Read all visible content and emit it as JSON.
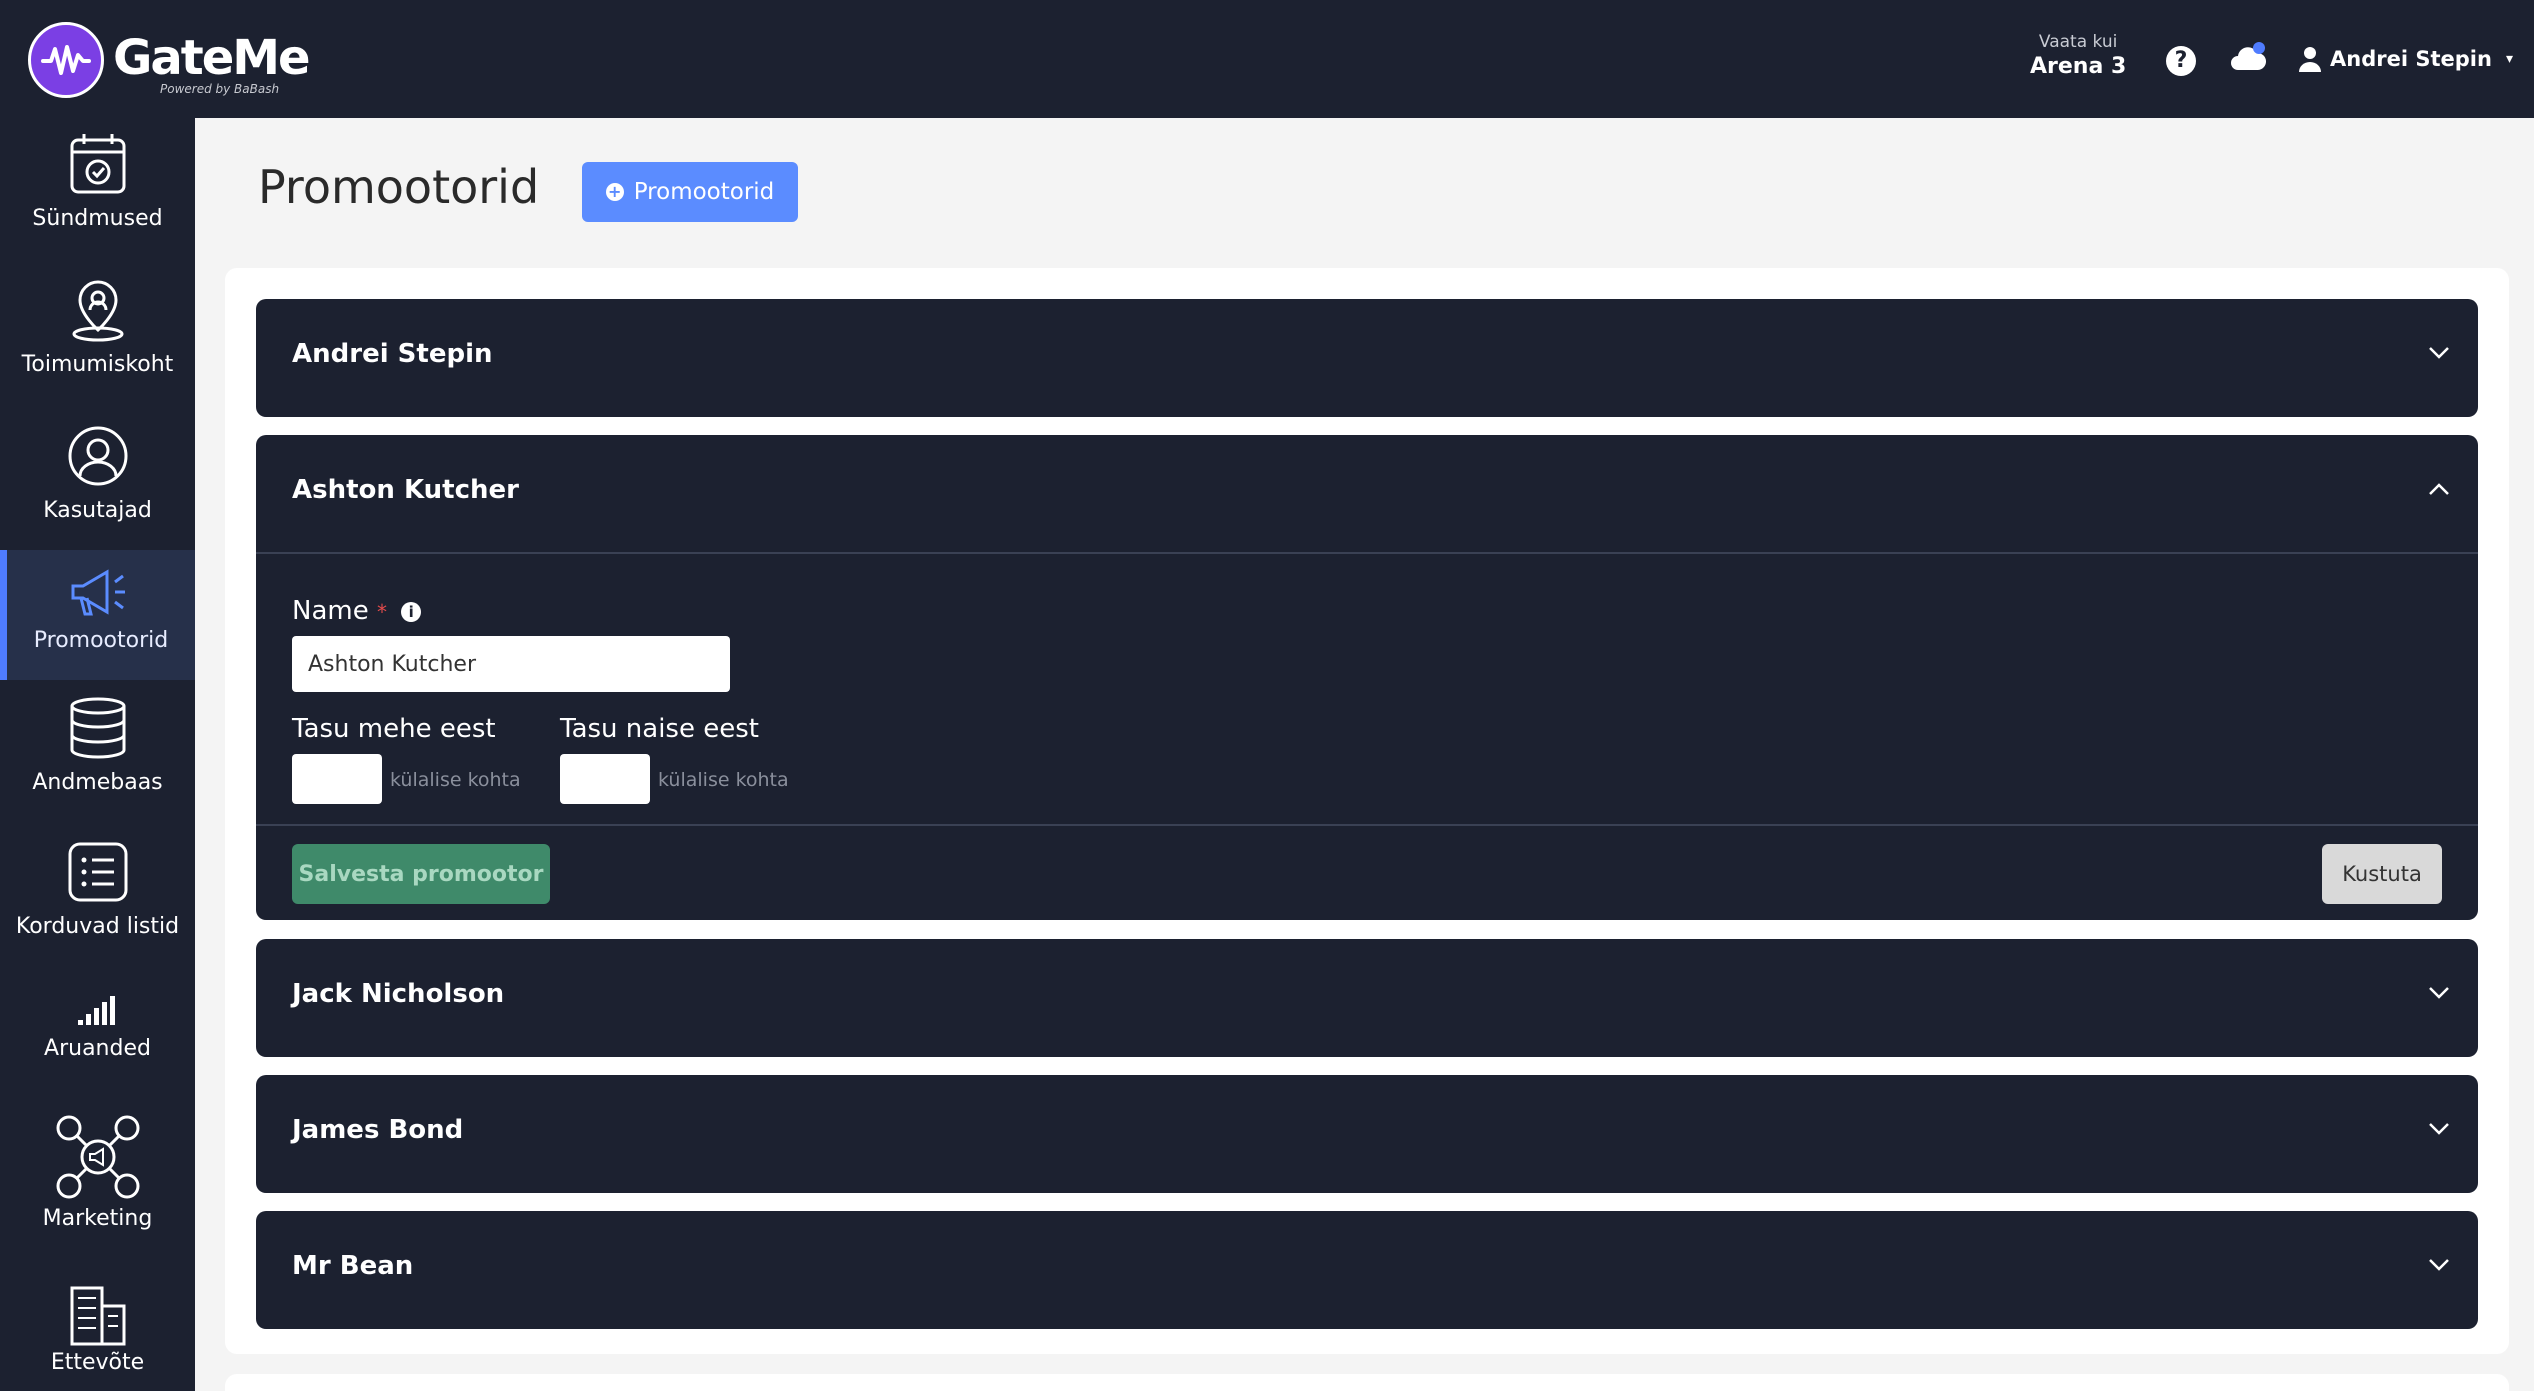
{
  "header": {
    "brand": "GateMe",
    "brand_sub": "Powered by BaBash",
    "view_as_label": "Vaata kui",
    "view_as_value": "Arena 3",
    "help_glyph": "?",
    "user_name": "Andrei Stepin"
  },
  "sidebar": {
    "items": [
      {
        "label": "Sündmused",
        "icon": "calendar-check-icon"
      },
      {
        "label": "Toimumiskoht",
        "icon": "map-pin-icon"
      },
      {
        "label": "Kasutajad",
        "icon": "user-circle-icon"
      },
      {
        "label": "Promootorid",
        "icon": "megaphone-icon"
      },
      {
        "label": "Andmebaas",
        "icon": "database-icon"
      },
      {
        "label": "Korduvad listid",
        "icon": "list-icon"
      },
      {
        "label": "Aruanded",
        "icon": "signal-bars-icon"
      },
      {
        "label": "Marketing",
        "icon": "social-network-icon"
      },
      {
        "label": "Ettevõte",
        "icon": "building-icon"
      }
    ],
    "active_index": 3
  },
  "main": {
    "title": "Promootorid",
    "add_button_label": "Promootorid"
  },
  "promoters": [
    {
      "name": "Andrei Stepin",
      "expanded": false
    },
    {
      "name": "Ashton Kutcher",
      "expanded": true
    },
    {
      "name": "Jack Nicholson",
      "expanded": false
    },
    {
      "name": "James Bond",
      "expanded": false
    },
    {
      "name": "Mr Bean",
      "expanded": false
    }
  ],
  "form": {
    "name_label": "Name",
    "required_mark": "*",
    "info_glyph": "i",
    "name_value": "Ashton Kutcher",
    "man_fee_label": "Tasu mehe eest",
    "woman_fee_label": "Tasu naise eest",
    "man_fee_value": "",
    "woman_fee_value": "",
    "per_guest_text": "külalise kohta",
    "save_label": "Salvesta promootor",
    "delete_label": "Kustuta"
  },
  "colors": {
    "dark": "#1c2130",
    "accent": "#5b8cff",
    "logo": "#7b3fe4",
    "save": "#3f8a6a"
  }
}
